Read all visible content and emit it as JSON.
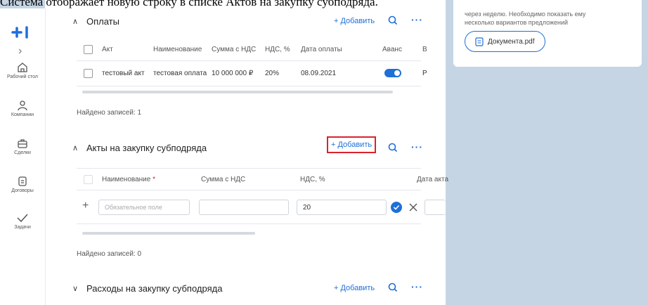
{
  "caption": "Система отображает новую строку в списке Актов на закупку субподряда.",
  "sidebar": {
    "items": [
      {
        "label": "Рабочий стол",
        "icon": "home-icon"
      },
      {
        "label": "Компании",
        "icon": "person-icon"
      },
      {
        "label": "Сделки",
        "icon": "briefcase-icon"
      },
      {
        "label": "Договоры",
        "icon": "document-icon"
      },
      {
        "label": "Задачи",
        "icon": "check-icon"
      }
    ]
  },
  "payments": {
    "title": "Оплаты",
    "add_label": "+ Добавить",
    "columns": [
      "Акт",
      "Наименование",
      "Сумма с НДС",
      "НДС, %",
      "Дата оплаты",
      "Аванс",
      "В"
    ],
    "rows": [
      {
        "act": "тестовый акт",
        "name": "тестовая оплата",
        "sum": "10 000 000 ₽",
        "vat": "20%",
        "date": "08.09.2021",
        "advance": true,
        "extra": "Р"
      }
    ],
    "found": "Найдено записей: 1"
  },
  "acts": {
    "title": "Акты на закупку субподряда",
    "add_label": "+ Добавить",
    "columns": [
      "Наименование",
      "Сумма с НДС",
      "НДС, %",
      "Дата акта"
    ],
    "required_mark": "*",
    "new_row": {
      "name_placeholder": "Обязательное поле",
      "sum": "",
      "vat": "20"
    },
    "found": "Найдено записей: 0"
  },
  "expenses": {
    "title": "Расходы на закупку субподряда",
    "add_label": "+ Добавить"
  },
  "card": {
    "text_line1": "через неделю. Необходимо показать ему",
    "text_line2": "несколько вариантов предложений",
    "file": "Документа.pdf"
  },
  "colors": {
    "accent": "#1e6fd9",
    "highlight": "#d9232e",
    "background": "#c5d5e4"
  }
}
